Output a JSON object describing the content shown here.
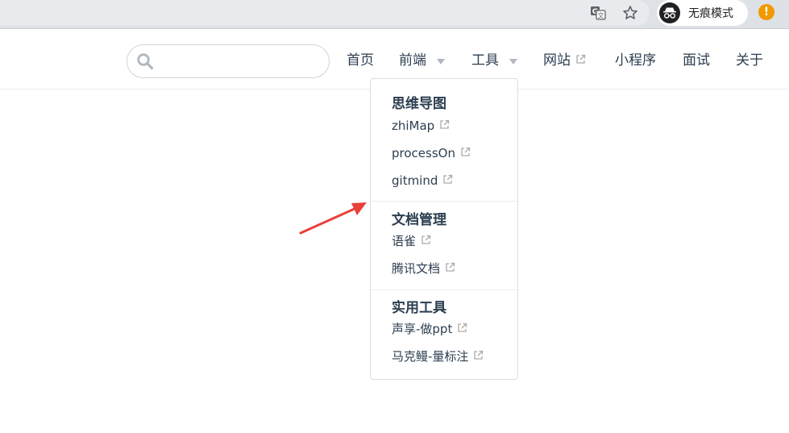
{
  "browser": {
    "incognito_label": "无痕模式",
    "alert_symbol": "!",
    "icons": [
      "translate-icon",
      "star-icon",
      "incognito-icon"
    ]
  },
  "search": {
    "placeholder": "",
    "value": ""
  },
  "nav": {
    "items": [
      {
        "label": "首页"
      },
      {
        "label": "前端",
        "has_dropdown": true
      },
      {
        "label": "工具",
        "has_dropdown": true,
        "open": true
      },
      {
        "label": "网站",
        "external": true
      },
      {
        "label": "小程序"
      },
      {
        "label": "面试"
      },
      {
        "label": "关于"
      }
    ]
  },
  "dropdown": {
    "groups": [
      {
        "title": "思维导图",
        "links": [
          {
            "label": "zhiMap",
            "external": true
          },
          {
            "label": "processOn",
            "external": true
          },
          {
            "label": "gitmind",
            "external": true
          }
        ]
      },
      {
        "title": "文档管理",
        "links": [
          {
            "label": "语雀",
            "external": true
          },
          {
            "label": "腾讯文档",
            "external": true
          }
        ]
      },
      {
        "title": "实用工具",
        "links": [
          {
            "label": "声享-做ppt",
            "external": true
          },
          {
            "label": "马克鳗-量标注",
            "external": true
          }
        ]
      }
    ]
  },
  "colors": {
    "text": "#2c3e50",
    "annotation_arrow": "#e8403a",
    "incognito_alert": "#f29900"
  }
}
